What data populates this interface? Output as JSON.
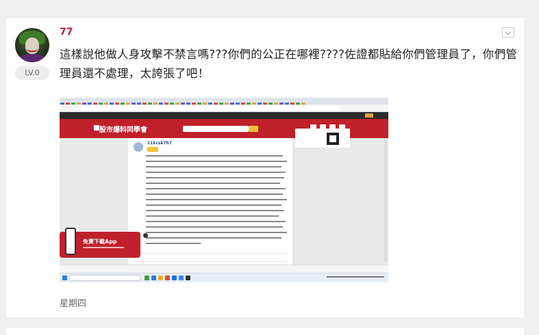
{
  "post": {
    "username": "77",
    "level_badge": "LV.0",
    "text": "這樣說他做人身攻擊不禁言嗎???你們的公正在哪裡????佐證都貼給你們管理員了，你們管理員還不處理，太誇張了吧！",
    "weekday": "星期四",
    "accent_color": "#b0203a"
  },
  "screenshot": {
    "site_title": "股市爆料同學會",
    "app_ad_label": "免費下載App",
    "commenter_name": "11kcsk7h7"
  },
  "icons": {
    "more_menu": "chevron-down-icon",
    "avatar": "joker-avatar",
    "app_ad": "phone-icon",
    "app_close": "close-icon"
  }
}
